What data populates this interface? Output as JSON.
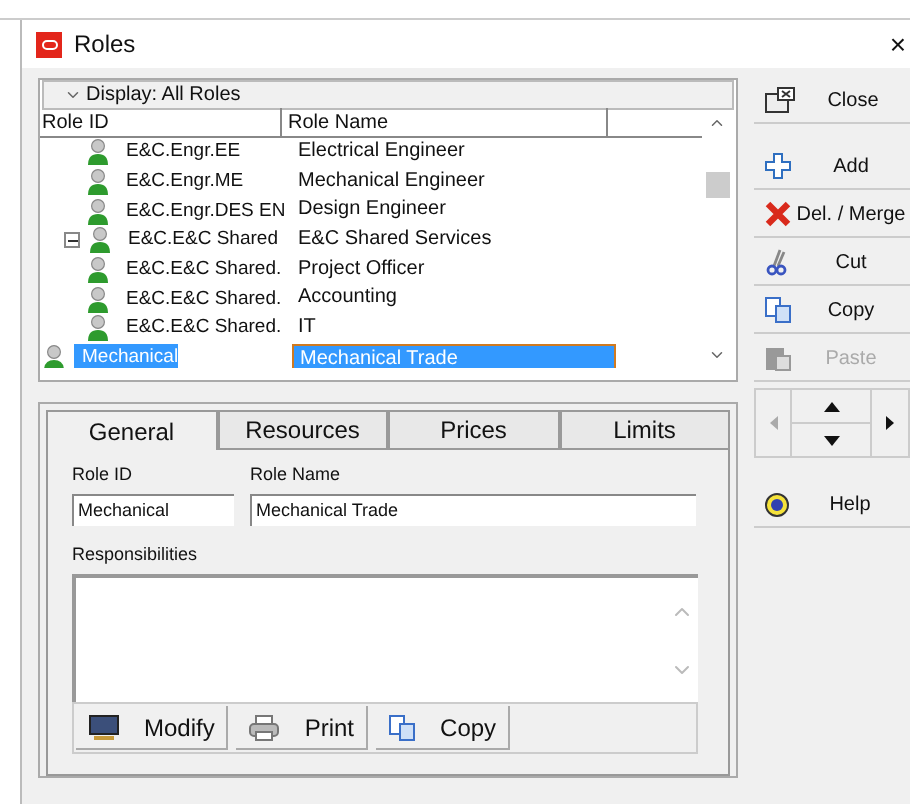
{
  "window": {
    "title": "Roles",
    "close": "×"
  },
  "grid": {
    "display": "Display: All Roles",
    "columns": [
      "Role ID",
      "Role Name"
    ],
    "rows": [
      {
        "children": [
          {
            "children": [
              {
                "id": "E&C.Engr.EE",
                "name": "Electrical Engineer",
                "selected": false
              },
              {
                "id": "E&C.Engr.ME",
                "name": "Mechanical Engineer",
                "selected": false
              },
              {
                "id": "E&C.Engr.DES EN",
                "name": "Design Engineer",
                "selected": false
              }
            ]
          },
          {
            "id": "E&C.E&C Shared",
            "name": "E&C Shared Services",
            "selected": false,
            "expanded": true,
            "children": [
              {
                "id": "E&C.E&C Shared.",
                "name": "Project Officer",
                "selected": false
              },
              {
                "id": "E&C.E&C Shared.",
                "name": "Accounting",
                "selected": false
              },
              {
                "id": "E&C.E&C Shared.",
                "name": "IT",
                "selected": false
              }
            ]
          }
        ]
      },
      {
        "id": "Mechanical",
        "name": "Mechanical Trade",
        "selected": true
      }
    ]
  },
  "side_buttons": [
    {
      "label": "Close",
      "kind": "close",
      "disabled": false
    },
    {
      "label": "Add",
      "kind": "add",
      "disabled": false
    },
    {
      "label": "Del. / Merge",
      "kind": "delete",
      "disabled": false
    },
    {
      "label": "Cut",
      "kind": "cut",
      "disabled": false
    },
    {
      "label": "Copy",
      "kind": "copy",
      "disabled": false
    },
    {
      "label": "Paste",
      "kind": "paste",
      "disabled": true
    }
  ],
  "help": "Help",
  "tabs": [
    {
      "label": "General",
      "selected": true
    },
    {
      "label": "Resources",
      "selected": false
    },
    {
      "label": "Prices",
      "selected": false
    },
    {
      "label": "Limits",
      "selected": false
    }
  ],
  "form": {
    "role_id_label": "Role ID",
    "role_id": "Mechanical",
    "role_name_label": "Role Name",
    "role_name": "Mechanical Trade",
    "responsibilities_label": "Responsibilities"
  },
  "bottom_buttons": [
    {
      "label": "Modify",
      "kind": "modify"
    },
    {
      "label": "Print",
      "kind": "print"
    },
    {
      "label": "Copy",
      "kind": "copy"
    }
  ]
}
